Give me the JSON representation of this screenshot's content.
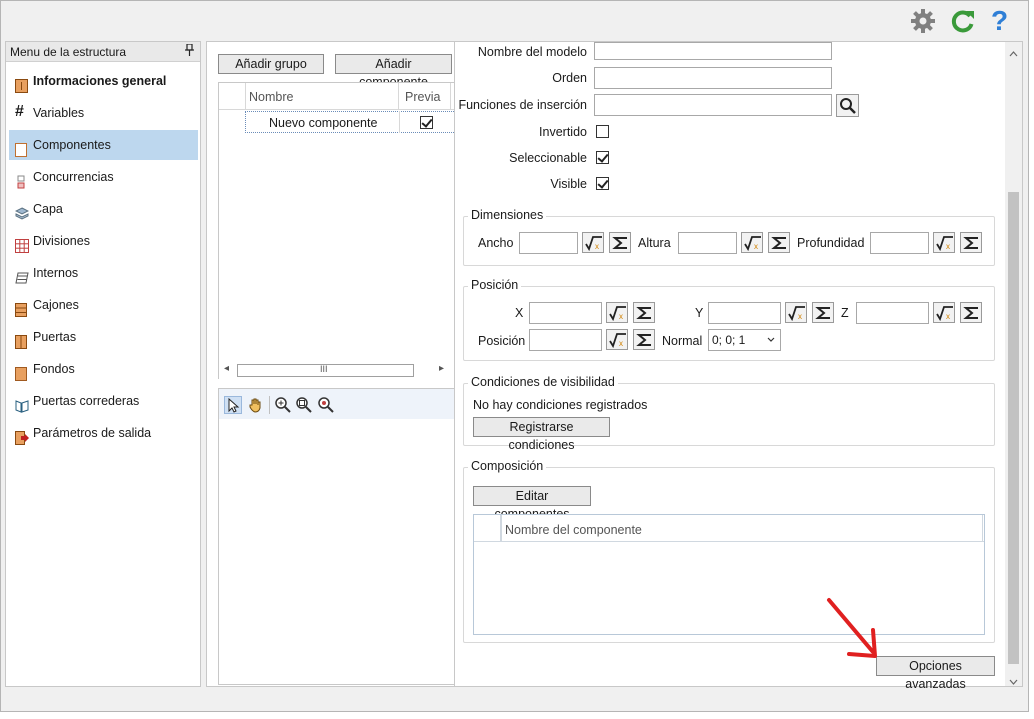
{
  "toolbar": {
    "settings_icon": "gear-icon",
    "refresh_icon": "refresh-icon",
    "help_icon": "question-icon",
    "help_glyph": "?"
  },
  "sidebar": {
    "title": "Menu de la estructura",
    "pin_glyph": "⬇",
    "items": [
      {
        "label": "Informaciones general",
        "icon": "info-icon"
      },
      {
        "label": "Variables",
        "icon": "hash-icon"
      },
      {
        "label": "Componentes",
        "icon": "component-icon"
      },
      {
        "label": "Concurrencias",
        "icon": "concurrency-icon"
      },
      {
        "label": "Capa",
        "icon": "layer-icon"
      },
      {
        "label": "Divisiones",
        "icon": "grid-icon"
      },
      {
        "label": "Internos",
        "icon": "internal-icon"
      },
      {
        "label": "Cajones",
        "icon": "drawer-icon"
      },
      {
        "label": "Puertas",
        "icon": "door-icon"
      },
      {
        "label": "Fondos",
        "icon": "back-panel-icon"
      },
      {
        "label": "Puertas correderas",
        "icon": "sliding-door-icon"
      },
      {
        "label": "Parámetros de salida",
        "icon": "output-icon"
      }
    ],
    "selected_index": 2
  },
  "middle": {
    "add_group_label": "Añadir grupo",
    "add_component_label": "Añadir componente",
    "columns": [
      "Nombre",
      "Previa"
    ],
    "rows": [
      {
        "name": "Nuevo componente",
        "preview": true
      }
    ],
    "scroll_thumb_glyph": "III",
    "scroll_left_glyph": "◂",
    "scroll_right_glyph": "▸"
  },
  "form": {
    "model_name_label": "Nombre del modelo",
    "order_label": "Orden",
    "insert_functions_label": "Funciones de inserción",
    "inverted_label": "Invertido",
    "inverted": false,
    "selectable_label": "Seleccionable",
    "selectable": true,
    "visible_label": "Visible",
    "visible": true,
    "dimensions": {
      "title": "Dimensiones",
      "width_label": "Ancho",
      "height_label": "Altura",
      "depth_label": "Profundidad"
    },
    "position": {
      "title": "Posición",
      "x_label": "X",
      "y_label": "Y",
      "z_label": "Z",
      "position_label": "Posición",
      "normal_label": "Normal",
      "normal_value": "0; 0; 1"
    },
    "visibility": {
      "title": "Condiciones de visibilidad",
      "empty_text": "No hay condiciones registrados",
      "register_label": "Registrarse condiciones"
    },
    "composition": {
      "title": "Composición",
      "edit_label": "Editar componentes",
      "column": "Nombre del componente"
    },
    "advanced_label": "Opciones avanzadas"
  },
  "colors": {
    "selected_bg": "#bdd7ee",
    "refresh_green": "#3a9a3a",
    "help_blue": "#2f7fd6",
    "gear_gray": "#808080",
    "arrow_red": "#e02020"
  }
}
